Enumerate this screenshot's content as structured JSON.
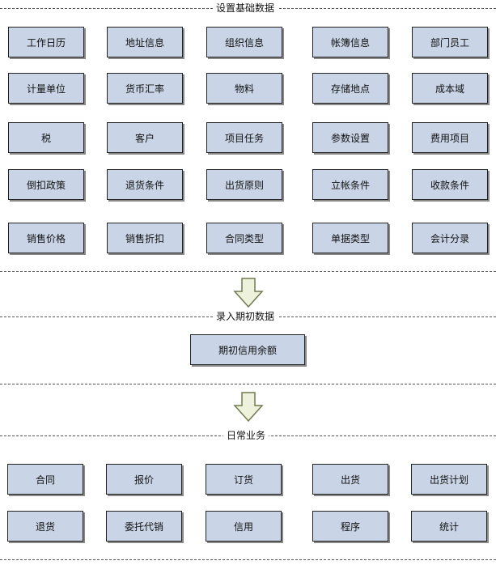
{
  "sections": {
    "setup": {
      "title": "设置基础数据",
      "rows": [
        [
          "工作日历",
          "地址信息",
          "组织信息",
          "帐簿信息",
          "部门员工"
        ],
        [
          "计量单位",
          "货币汇率",
          "物料",
          "存储地点",
          "成本域"
        ],
        [
          "税",
          "客户",
          "项目任务",
          "参数设置",
          "费用项目"
        ],
        [
          "倒扣政策",
          "退货条件",
          "出货原则",
          "立帐条件",
          "收款条件"
        ],
        [
          "销售价格",
          "销售折扣",
          "合同类型",
          "单据类型",
          "会计分录"
        ]
      ]
    },
    "opening": {
      "title": "录入期初数据",
      "items": [
        "期初信用余额"
      ]
    },
    "daily": {
      "title": "日常业务",
      "rows": [
        [
          "合同",
          "报价",
          "订货",
          "出货",
          "出货计划"
        ],
        [
          "退货",
          "委托代销",
          "信用",
          "程序",
          "统计"
        ]
      ]
    }
  },
  "colors": {
    "box_fill": "#c9d5e6",
    "box_border": "#222222",
    "arrow_fill": "#eef2dd",
    "arrow_stroke": "#6e7a50"
  },
  "icons": [
    "down-arrow-icon",
    "down-arrow-icon"
  ]
}
